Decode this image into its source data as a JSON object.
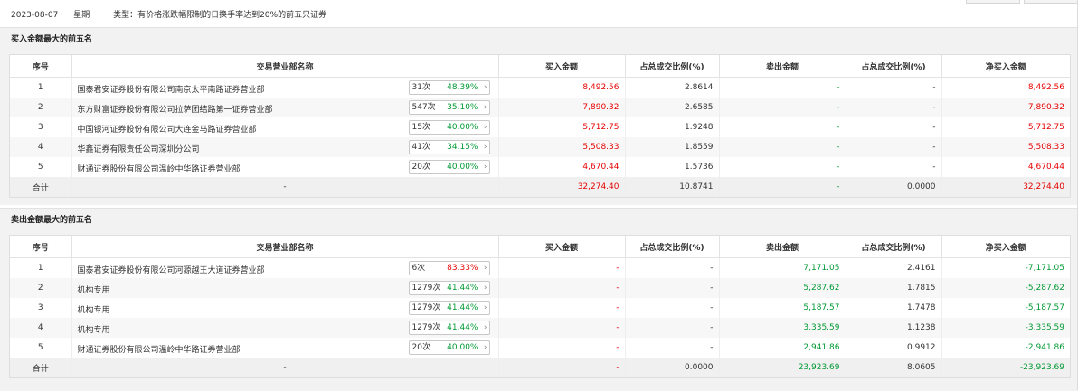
{
  "header": {
    "date": "2023-08-07",
    "weekday": "星期一",
    "type_label": "类型：有价格涨跌幅限制的日换手率达到20%的前五只证券"
  },
  "buy_section": {
    "title": "买入金额最大的前五名",
    "columns": [
      "序号",
      "交易营业部名称",
      "买入金额",
      "占总成交比例(%)",
      "卖出金额",
      "占总成交比例(%)",
      "净买入金额"
    ],
    "rows": [
      {
        "idx": "1",
        "name": "国泰君安证券股份有限公司南京太平南路证券营业部",
        "count": "31次",
        "rate": "48.39%",
        "buy": "8,492.56",
        "buy_pct": "2.8614",
        "sell": "-",
        "sell_pct": "-",
        "net": "8,492.56"
      },
      {
        "idx": "2",
        "name": "东方财富证券股份有限公司拉萨团结路第一证券营业部",
        "count": "547次",
        "rate": "35.10%",
        "buy": "7,890.32",
        "buy_pct": "2.6585",
        "sell": "-",
        "sell_pct": "-",
        "net": "7,890.32"
      },
      {
        "idx": "3",
        "name": "中国银河证券股份有限公司大连金马路证券营业部",
        "count": "15次",
        "rate": "40.00%",
        "buy": "5,712.75",
        "buy_pct": "1.9248",
        "sell": "-",
        "sell_pct": "-",
        "net": "5,712.75"
      },
      {
        "idx": "4",
        "name": "华鑫证券有限责任公司深圳分公司",
        "count": "41次",
        "rate": "34.15%",
        "buy": "5,508.33",
        "buy_pct": "1.8559",
        "sell": "-",
        "sell_pct": "-",
        "net": "5,508.33"
      },
      {
        "idx": "5",
        "name": "财通证券股份有限公司温岭中华路证券营业部",
        "count": "20次",
        "rate": "40.00%",
        "buy": "4,670.44",
        "buy_pct": "1.5736",
        "sell": "-",
        "sell_pct": "-",
        "net": "4,670.44"
      }
    ],
    "total": {
      "label": "合计",
      "name": "-",
      "buy": "32,274.40",
      "buy_pct": "10.8741",
      "sell": "-",
      "sell_pct": "0.0000",
      "net": "32,274.40"
    }
  },
  "sell_section": {
    "title": "卖出金额最大的前五名",
    "columns": [
      "序号",
      "交易营业部名称",
      "买入金额",
      "占总成交比例(%)",
      "卖出金额",
      "占总成交比例(%)",
      "净买入金额"
    ],
    "rows": [
      {
        "idx": "1",
        "name": "国泰君安证券股份有限公司河源越王大道证券营业部",
        "count": "6次",
        "rate": "83.33%",
        "buy": "-",
        "buy_pct": "-",
        "sell": "7,171.05",
        "sell_pct": "2.4161",
        "net": "-7,171.05"
      },
      {
        "idx": "2",
        "name": "机构专用",
        "count": "1279次",
        "rate": "41.44%",
        "buy": "-",
        "buy_pct": "-",
        "sell": "5,287.62",
        "sell_pct": "1.7815",
        "net": "-5,287.62"
      },
      {
        "idx": "3",
        "name": "机构专用",
        "count": "1279次",
        "rate": "41.44%",
        "buy": "-",
        "buy_pct": "-",
        "sell": "5,187.57",
        "sell_pct": "1.7478",
        "net": "-5,187.57"
      },
      {
        "idx": "4",
        "name": "机构专用",
        "count": "1279次",
        "rate": "41.44%",
        "buy": "-",
        "buy_pct": "-",
        "sell": "3,335.59",
        "sell_pct": "1.1238",
        "net": "-3,335.59"
      },
      {
        "idx": "5",
        "name": "财通证券股份有限公司温岭中华路证券营业部",
        "count": "20次",
        "rate": "40.00%",
        "buy": "-",
        "buy_pct": "-",
        "sell": "2,941.86",
        "sell_pct": "0.9912",
        "net": "-2,941.86"
      }
    ],
    "total": {
      "label": "合计",
      "name": "-",
      "buy": "-",
      "buy_pct": "0.0000",
      "sell": "23,923.69",
      "sell_pct": "8.0605",
      "net": "-23,923.69"
    }
  },
  "colors": {
    "red": "#e60000",
    "green": "#009933",
    "section_bg": "#f2f2f2"
  }
}
